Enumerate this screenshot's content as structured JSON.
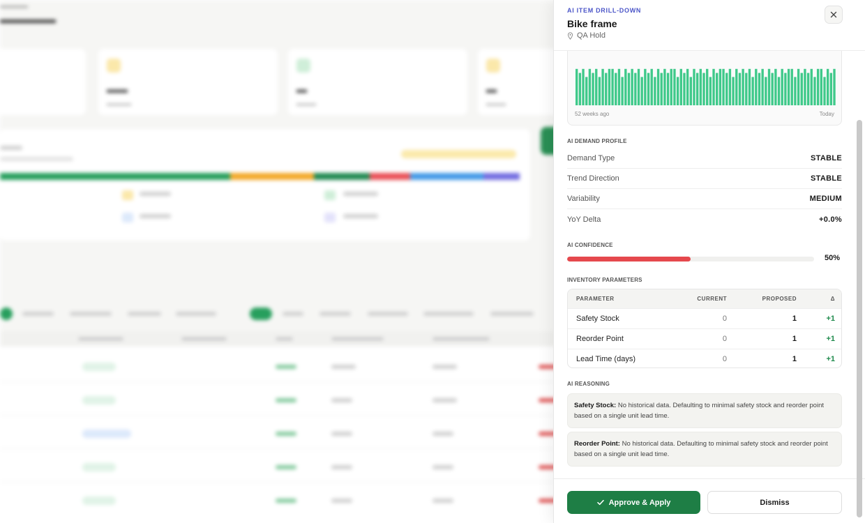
{
  "drawer": {
    "eyebrow": "AI ITEM DRILL-DOWN",
    "title": "Bike frame",
    "location": "QA Hold",
    "close_icon": "close-icon"
  },
  "chart_data": {
    "type": "bar",
    "title": "",
    "xlabel": "",
    "ylabel": "",
    "x_start_label": "52 weeks ago",
    "x_end_label": "Today",
    "color": "#3fc98a",
    "values": [
      9,
      8,
      9,
      7,
      9,
      8,
      9,
      7,
      9,
      8,
      9,
      9,
      8,
      9,
      7,
      9,
      8,
      9,
      8,
      9,
      7,
      9,
      8,
      9,
      7,
      9,
      8,
      9,
      8,
      9,
      9,
      7,
      9,
      8,
      9,
      7,
      9,
      8,
      9,
      8,
      9,
      7,
      9,
      8,
      9,
      9,
      8,
      9,
      7,
      9,
      8,
      9,
      8,
      9,
      7,
      9,
      8,
      9,
      7,
      9,
      8,
      9,
      7,
      9,
      8,
      9,
      9,
      7,
      9,
      8,
      9,
      8,
      9,
      7,
      9,
      9,
      7,
      9,
      8,
      9
    ],
    "ylim": [
      0,
      10
    ]
  },
  "demand_profile": {
    "label": "AI DEMAND PROFILE",
    "rows": [
      {
        "key": "Demand Type",
        "value": "STABLE"
      },
      {
        "key": "Trend Direction",
        "value": "STABLE"
      },
      {
        "key": "Variability",
        "value": "MEDIUM"
      },
      {
        "key": "YoY Delta",
        "value": "+0.0%"
      }
    ]
  },
  "confidence": {
    "label": "AI CONFIDENCE",
    "value_text": "50%",
    "value": 0.5,
    "color": "#e5484d"
  },
  "inventory": {
    "label": "INVENTORY PARAMETERS",
    "headers": [
      "PARAMETER",
      "CURRENT",
      "PROPOSED",
      "Δ"
    ],
    "rows": [
      {
        "param": "Safety Stock",
        "current": "0",
        "proposed": "1",
        "delta": "+1"
      },
      {
        "param": "Reorder Point",
        "current": "0",
        "proposed": "1",
        "delta": "+1"
      },
      {
        "param": "Lead Time (days)",
        "current": "0",
        "proposed": "1",
        "delta": "+1"
      }
    ]
  },
  "reasoning": {
    "label": "AI REASONING",
    "items": [
      {
        "title": "Safety Stock:",
        "text": " No historical data. Defaulting to minimal safety stock and reorder point based on a single unit lead time."
      },
      {
        "title": "Reorder Point:",
        "text": " No historical data. Defaulting to minimal safety stock and reorder point based on a single unit lead time."
      }
    ]
  },
  "footer": {
    "approve_label": "Approve & Apply",
    "dismiss_label": "Dismiss"
  }
}
